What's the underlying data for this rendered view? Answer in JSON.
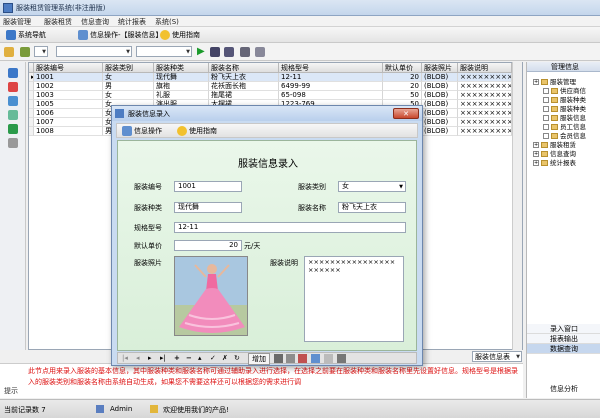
{
  "window": {
    "title": "服装租赁管理系统(非注册版)"
  },
  "menu": [
    "服装管理",
    "服装租赁",
    "信息查询",
    "统计报表",
    "系统(S)"
  ],
  "nav": {
    "system_nav": "系统导航",
    "info_op": "信息操作-【服装信息】",
    "help": "使用指南"
  },
  "grid": {
    "columns": [
      "服装编号",
      "服装类别",
      "服装种类",
      "服装名称",
      "规格型号",
      "默认单价",
      "服装照片",
      "服装说明"
    ],
    "rows": [
      [
        "1001",
        "女",
        "现代舞",
        "粉飞天上衣",
        "12-11",
        "20",
        "(BLOB)",
        "×××××××××××"
      ],
      [
        "1002",
        "男",
        "旗袍",
        "花袄面长袍",
        "6499-99",
        "20",
        "(BLOB)",
        "×××××××××××"
      ],
      [
        "1003",
        "女",
        "礼服",
        "拖尾裙",
        "65-098",
        "50",
        "(BLOB)",
        "×××××××××××"
      ],
      [
        "1005",
        "女",
        "演出服",
        "大摆裙",
        "1223-769",
        "50",
        "(BLOB)",
        "×××××××××××"
      ],
      [
        "1006",
        "女",
        "",
        "",
        "",
        "",
        "(BLOB)",
        "×××××××××××"
      ],
      [
        "1007",
        "女",
        "",
        "",
        "",
        "",
        "(BLOB)",
        "×××××××××××"
      ],
      [
        "1008",
        "男",
        "",
        "",
        "",
        "",
        "(BLOB)",
        "×××××××××××"
      ]
    ]
  },
  "right_panel": {
    "title": "管理信息",
    "tree": [
      {
        "label": "服装管理",
        "level": 1
      },
      {
        "label": "供应商信",
        "level": 2
      },
      {
        "label": "服装种类",
        "level": 2
      },
      {
        "label": "服装种类",
        "level": 2
      },
      {
        "label": "服装信息",
        "level": 2
      },
      {
        "label": "员工信息",
        "level": 2
      },
      {
        "label": "会员信息",
        "level": 2
      },
      {
        "label": "服装租赁",
        "level": 1
      },
      {
        "label": "信息查询",
        "level": 1
      },
      {
        "label": "统计报表",
        "level": 1
      }
    ],
    "links": [
      "录入窗口",
      "报表输出",
      "数据查询",
      "信息分析"
    ]
  },
  "dialog": {
    "title": "服装信息录入",
    "tab_info": "信息操作",
    "tab_help": "使用指南",
    "form_title": "服装信息录入",
    "fields": {
      "code_label": "服装编号",
      "code": "1001",
      "category_label": "服装类别",
      "category": "女",
      "kind_label": "服装种类",
      "kind": "现代舞",
      "name_label": "服装名称",
      "name": "粉飞天上衣",
      "spec_label": "规格型号",
      "spec": "12-11",
      "price_label": "默认单价",
      "price": "20",
      "price_unit": "元/天",
      "photo_label": "服装照片",
      "desc_label": "服装说明",
      "desc": "××××××××××××××××××××××"
    },
    "nav_add": "增加"
  },
  "bottom": {
    "combo": "服装信息表",
    "note_label": "提示",
    "note": "此节点用来录入服装的基本信息，其中服装种类和服装名称可通过辅助录入进行选择，在选择之前要在服装种类和服装名称里先设置好信息。规格型号是根据录入的服装类别和服装名称由系统自动生成，如果您不需要这样还可以根据您的需求进行调"
  },
  "status": {
    "records": "当前记录数 7",
    "user": "Admin",
    "welcome": "欢迎使用我们的产品!"
  },
  "colors": {
    "accent": "#4d7cc2",
    "form_bg": "#e2f3e2",
    "note_text": "#dd1111"
  }
}
